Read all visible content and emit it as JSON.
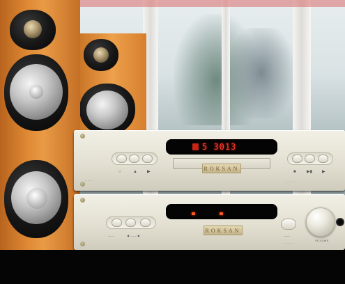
{
  "scene": {
    "subject": "hifi-system",
    "colors": {
      "speaker_wood": "#e08a35",
      "faceplate": "#e3e0d2",
      "display_red": "#ff3b30",
      "background_floor": "#050505"
    }
  },
  "cd_player": {
    "logo": "ROKSAN",
    "display_text": "5 3013"
  },
  "amplifier": {
    "logo": "ROKSAN",
    "volume_label": "VOLUME"
  }
}
